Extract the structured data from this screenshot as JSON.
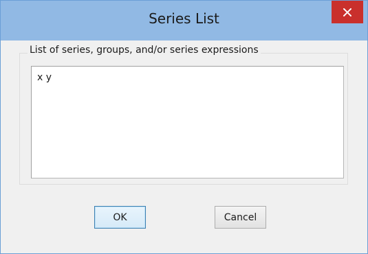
{
  "window": {
    "title": "Series List",
    "close_icon": "close-icon"
  },
  "group": {
    "label": "List of series, groups, and/or series expressions"
  },
  "listbox": {
    "value": "x y"
  },
  "buttons": {
    "ok_label": "OK",
    "cancel_label": "Cancel"
  },
  "colors": {
    "titlebar": "#91b9e4",
    "close_button": "#c9302c",
    "dialog_background": "#f0f0f0"
  }
}
